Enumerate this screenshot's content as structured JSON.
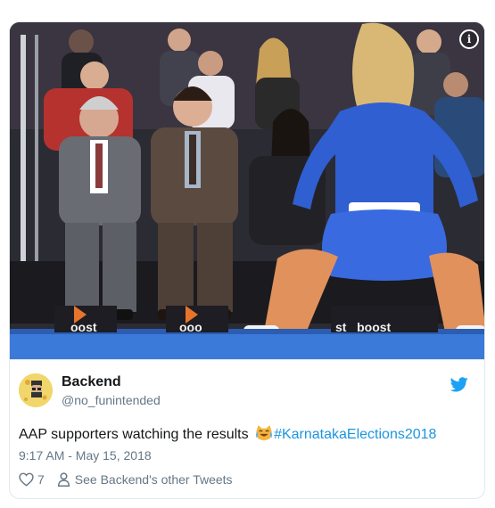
{
  "tweet": {
    "author": {
      "name": "Backend",
      "handle": "@no_funintended"
    },
    "text": "AAP supporters watching the results",
    "emoji": "laughing-crying-cat-emoji",
    "hashtag": "#KarnatakaElections2018",
    "timestamp": "9:17 AM - May 15, 2018",
    "like_count": "7",
    "profile_link": "See Backend's other Tweets"
  },
  "media": {
    "info_glyph": "i",
    "court_text_left": "oost",
    "court_text_mid": "ooo",
    "court_text_right": "st   boost"
  },
  "colors": {
    "link": "#1b95e0",
    "text": "#14171a",
    "muted": "#657786",
    "border": "#e1e8ed",
    "twitter_blue": "#1da1f2"
  },
  "icons": {
    "info": "info-icon",
    "bird": "twitter-bird-icon",
    "heart": "heart-icon",
    "person": "person-icon"
  }
}
